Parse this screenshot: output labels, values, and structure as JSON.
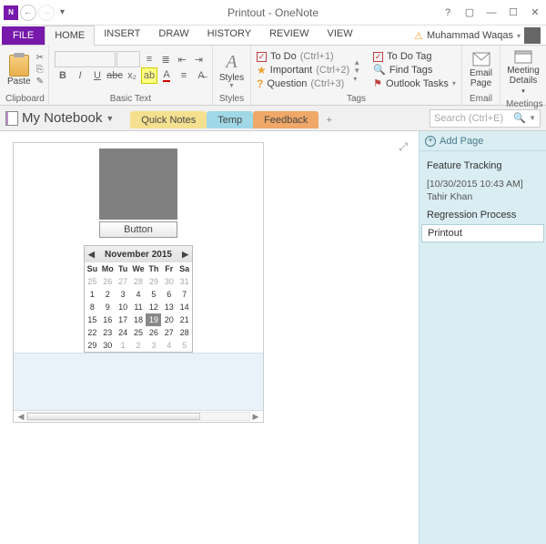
{
  "window": {
    "title": "Printout - OneNote"
  },
  "account": {
    "name": "Muhammad Waqas"
  },
  "ribbon": {
    "file": "FILE",
    "tabs": [
      "HOME",
      "INSERT",
      "DRAW",
      "HISTORY",
      "REVIEW",
      "VIEW"
    ],
    "active_tab": 0,
    "groups": {
      "clipboard": {
        "label": "Clipboard",
        "paste": "Paste"
      },
      "basictext": {
        "label": "Basic Text"
      },
      "styles": {
        "label": "Styles",
        "btn": "Styles"
      },
      "tags": {
        "label": "Tags",
        "items": [
          {
            "name": "To Do",
            "short": "(Ctrl+1)"
          },
          {
            "name": "Important",
            "short": "(Ctrl+2)"
          },
          {
            "name": "Question",
            "short": "(Ctrl+3)"
          }
        ],
        "right": [
          {
            "name": "To Do Tag"
          },
          {
            "name": "Find Tags"
          },
          {
            "name": "Outlook Tasks"
          }
        ]
      },
      "email": {
        "label": "Email",
        "btn1": "Email",
        "btn2": "Page"
      },
      "meetings": {
        "label": "Meetings",
        "btn1": "Meeting",
        "btn2": "Details"
      }
    }
  },
  "notebook": {
    "name": "My Notebook",
    "sections": [
      {
        "label": "Quick Notes",
        "color": "yellow"
      },
      {
        "label": "Temp",
        "color": "blue"
      },
      {
        "label": "Feedback",
        "color": "orange"
      }
    ],
    "active_section": 1,
    "search_placeholder": "Search (Ctrl+E)"
  },
  "page": {
    "button_label": "Button",
    "calendar": {
      "title": "November 2015",
      "headers": [
        "Su",
        "Mo",
        "Tu",
        "We",
        "Th",
        "Fr",
        "Sa"
      ],
      "weeks": [
        [
          {
            "d": 25,
            "dim": true
          },
          {
            "d": 26,
            "dim": true
          },
          {
            "d": 27,
            "dim": true
          },
          {
            "d": 28,
            "dim": true
          },
          {
            "d": 29,
            "dim": true
          },
          {
            "d": 30,
            "dim": true
          },
          {
            "d": 31,
            "dim": true
          }
        ],
        [
          {
            "d": 1
          },
          {
            "d": 2
          },
          {
            "d": 3
          },
          {
            "d": 4
          },
          {
            "d": 5
          },
          {
            "d": 6
          },
          {
            "d": 7
          }
        ],
        [
          {
            "d": 8
          },
          {
            "d": 9
          },
          {
            "d": 10
          },
          {
            "d": 11
          },
          {
            "d": 12
          },
          {
            "d": 13
          },
          {
            "d": 14
          }
        ],
        [
          {
            "d": 15
          },
          {
            "d": 16
          },
          {
            "d": 17
          },
          {
            "d": 18
          },
          {
            "d": 19,
            "sel": true
          },
          {
            "d": 20
          },
          {
            "d": 21
          }
        ],
        [
          {
            "d": 22
          },
          {
            "d": 23
          },
          {
            "d": 24
          },
          {
            "d": 25
          },
          {
            "d": 26
          },
          {
            "d": 27
          },
          {
            "d": 28
          }
        ],
        [
          {
            "d": 29
          },
          {
            "d": 30
          },
          {
            "d": 1,
            "dim": true
          },
          {
            "d": 2,
            "dim": true
          },
          {
            "d": 3,
            "dim": true
          },
          {
            "d": 4,
            "dim": true
          },
          {
            "d": 5,
            "dim": true
          }
        ]
      ]
    }
  },
  "rpane": {
    "add": "Add Page",
    "pages": [
      {
        "title": "Feature Tracking"
      },
      {
        "title": "[10/30/2015 10:43 AM] Tahir Khan",
        "sub": true
      },
      {
        "title": "Regression Process"
      },
      {
        "title": "Printout",
        "selected": true
      }
    ]
  }
}
